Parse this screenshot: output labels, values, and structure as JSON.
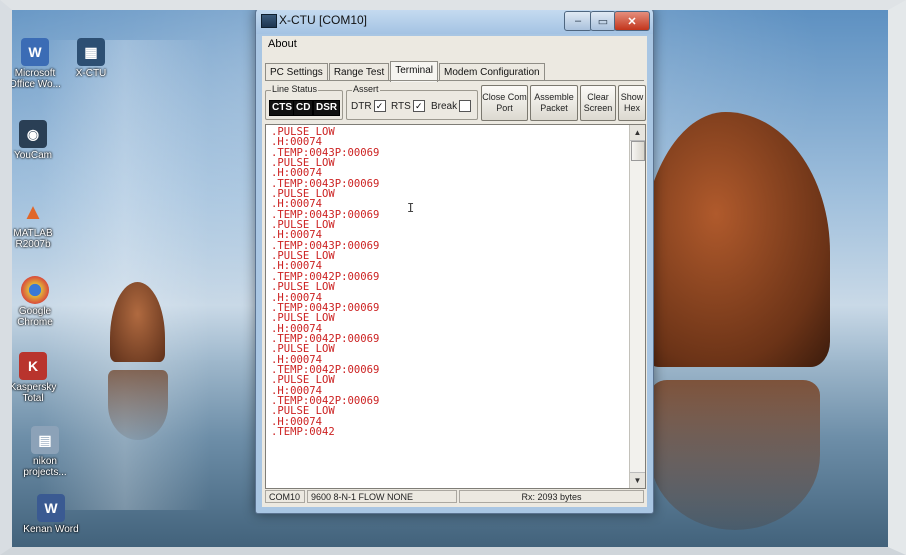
{
  "desktop": {
    "icons": [
      {
        "label": "Microsoft Office Wo...",
        "icon": "word-doc-icon",
        "color": "#3b6cb5"
      },
      {
        "label": "X-CTU",
        "icon": "xctu-icon",
        "color": "#2d4f73"
      },
      {
        "label": "YouCam",
        "icon": "camera-icon",
        "color": "#2a3f55"
      },
      {
        "label": "MATLAB R2007b",
        "icon": "matlab-icon",
        "color": "#c75a1c"
      },
      {
        "label": "Google Chrome",
        "icon": "chrome-icon",
        "color": "#d94b3b"
      },
      {
        "label": "Kaspersky Total",
        "icon": "kaspersky-icon",
        "color": "#b9342d"
      },
      {
        "label": "nikon projects...",
        "icon": "folder-icon",
        "color": "#8ca2b8"
      },
      {
        "label": "Kenan Word",
        "icon": "document-icon",
        "color": "#3a5a92"
      }
    ]
  },
  "window": {
    "title": "X-CTU  [COM10]",
    "controls": {
      "minimize": "–",
      "maximize": "▭",
      "close": "✕"
    },
    "menu": {
      "about": "About"
    },
    "tabs": [
      "PC Settings",
      "Range Test",
      "Terminal",
      "Modem Configuration"
    ],
    "active_tab": "Terminal",
    "line_status": {
      "title": "Line Status",
      "cts": "CTS",
      "cd": "CD",
      "dsr": "DSR"
    },
    "assert": {
      "title": "Assert",
      "dtr": {
        "label": "DTR",
        "checked": true,
        "mark": "✓"
      },
      "rts": {
        "label": "RTS",
        "checked": true,
        "mark": "✓"
      },
      "brk": {
        "label": "Break",
        "checked": false,
        "mark": ""
      }
    },
    "buttons": {
      "close_port": "Close Com Port",
      "assemble": "Assemble Packet",
      "clear": "Clear Screen",
      "show_hex": "Show Hex"
    },
    "terminal_text": ".PULSE LOW\n.H:00074\n.TEMP:0043P:00069\n.PULSE LOW\n.H:00074\n.TEMP:0043P:00069\n.PULSE LOW\n.H:00074\n.TEMP:0043P:00069\n.PULSE LOW\n.H:00074\n.TEMP:0043P:00069\n.PULSE LOW\n.H:00074\n.TEMP:0042P:00069\n.PULSE LOW\n.H:00074\n.TEMP:0043P:00069\n.PULSE LOW\n.H:00074\n.TEMP:0042P:00069\n.PULSE LOW\n.H:00074\n.TEMP:0042P:00069\n.PULSE LOW\n.H:00074\n.TEMP:0042P:00069\n.PULSE LOW\n.H:00074\n.TEMP:0042",
    "cursor_glyph": "I",
    "scroll": {
      "up": "▲",
      "down": "▼"
    },
    "status": {
      "port": "COM10",
      "settings": "9600 8-N-1  FLOW NONE",
      "rx": "Rx: 2093 bytes"
    }
  }
}
